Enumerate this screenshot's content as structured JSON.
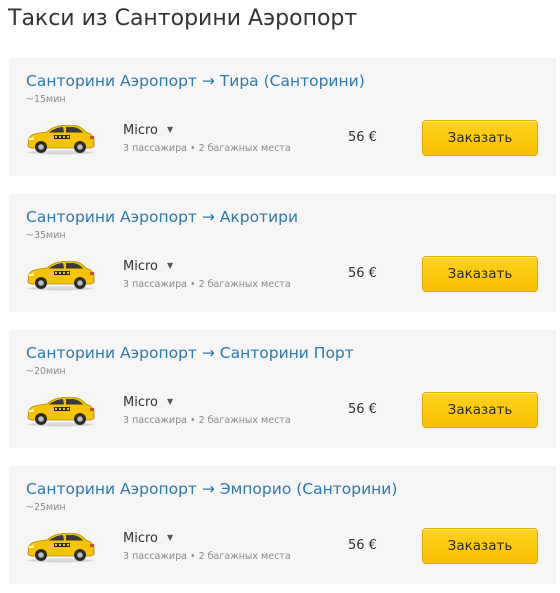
{
  "page": {
    "title": "Такси из Санторини Аэропорт"
  },
  "routes": [
    {
      "route": "Санторини Аэропорт → Тира (Санторини)",
      "duration": "~15мин",
      "car_class": "Micro",
      "capacity": "3 пассажира • 2 багажных места",
      "price": "56 €",
      "button": "Заказать"
    },
    {
      "route": "Санторини Аэропорт → Акротири",
      "duration": "~35мин",
      "car_class": "Micro",
      "capacity": "3 пассажира • 2 багажных места",
      "price": "56 €",
      "button": "Заказать"
    },
    {
      "route": "Санторини Аэропорт → Санторини Порт",
      "duration": "~20мин",
      "car_class": "Micro",
      "capacity": "3 пассажира • 2 багажных места",
      "price": "56 €",
      "button": "Заказать"
    },
    {
      "route": "Санторини Аэропорт → Эмпорио (Санторини)",
      "duration": "~25мин",
      "car_class": "Micro",
      "capacity": "3 пассажира • 2 багажных места",
      "price": "56 €",
      "button": "Заказать"
    }
  ],
  "icons": {
    "car": "taxi-car-icon",
    "dropdown": "caret-down-icon"
  },
  "colors": {
    "link": "#2f79a8",
    "button": "#fcc60b",
    "card_background": "#f6f6f6",
    "car_body": "#f5c400"
  }
}
